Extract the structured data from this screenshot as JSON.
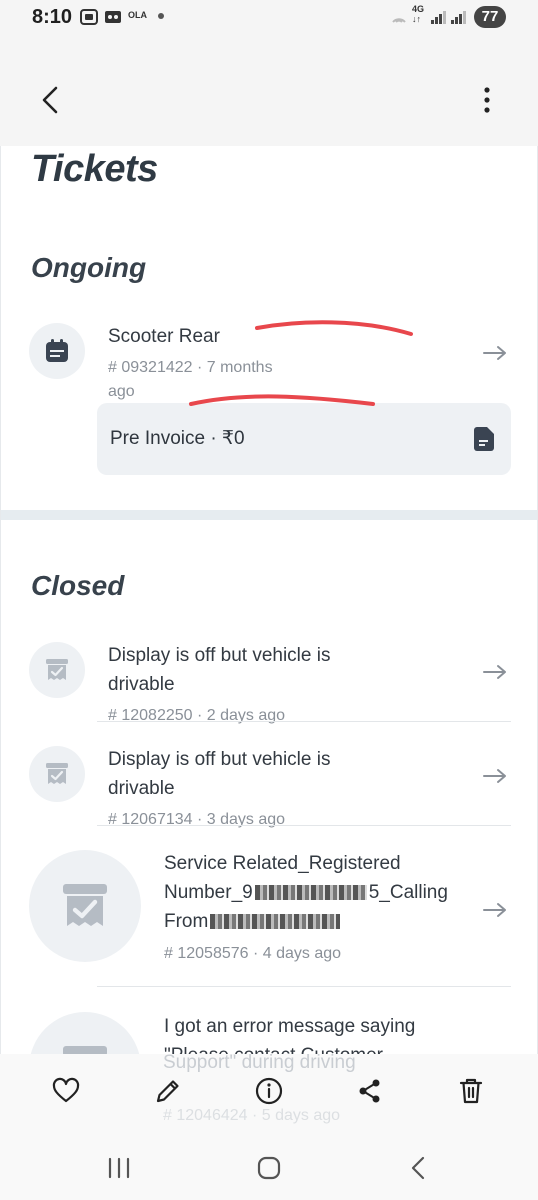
{
  "status_bar": {
    "time": "8:10",
    "carrier_badge": "OLA",
    "network": "4G",
    "battery": "77"
  },
  "header": {
    "back_icon": "chevron-left-icon",
    "more_icon": "more-vertical-icon"
  },
  "page": {
    "title": "Tickets"
  },
  "ongoing": {
    "section_title": "Ongoing",
    "ticket": {
      "title": "Scooter Rear",
      "meta_line1": "# 09321422 · 7 months",
      "meta_line2": "ago",
      "icon": "calendar-icon"
    },
    "invoice": {
      "label": "Pre Invoice · ₹0",
      "icon": "document-icon"
    }
  },
  "closed": {
    "section_title": "Closed",
    "tickets": [
      {
        "line1": "Display is off but vehicle is",
        "line2": "drivable",
        "meta": "# 12082250 · 2 days ago"
      },
      {
        "line1": "Display is off but vehicle is",
        "line2": "drivable",
        "meta": "# 12067134 · 3 days ago"
      },
      {
        "line1": "Service Related_Registered",
        "line2a": "Number_9",
        "line2b": "5_Calling",
        "line3": "From",
        "meta": "# 12058576 · 4 days ago"
      },
      {
        "line1": "I got an error message saying",
        "line2": "\"Please contact Customer",
        "line3": "Support\" during driving",
        "meta": "# 12046424 · 5 days ago"
      }
    ]
  },
  "action_bar": {
    "items": [
      "heart-icon",
      "pencil-icon",
      "info-icon",
      "share-icon",
      "trash-icon"
    ]
  },
  "nav_bar": {
    "items": [
      "recent-apps-icon",
      "home-icon",
      "back-icon"
    ]
  },
  "colors": {
    "accent_red": "#e8474c",
    "surface": "#eef1f4",
    "icon_dark": "#3a4452"
  }
}
